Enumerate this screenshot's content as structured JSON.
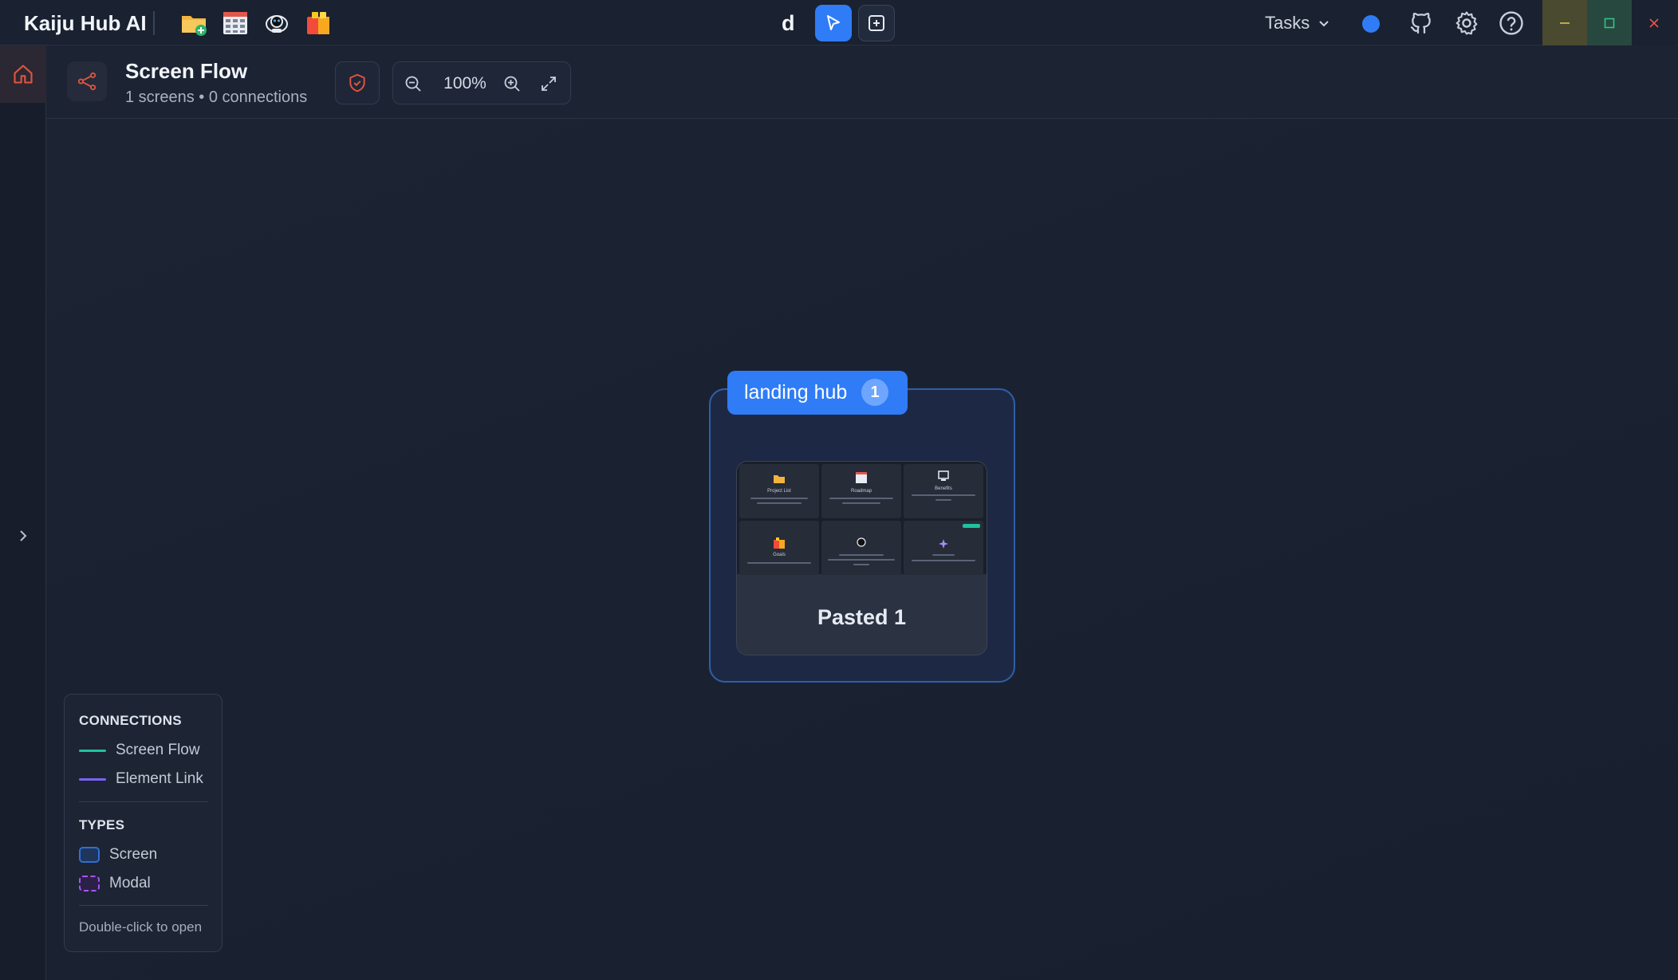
{
  "app": {
    "title": "Kaiju Hub AI",
    "mode_letter": "d",
    "tasks_label": "Tasks",
    "app_icons": [
      "folder-add-icon",
      "grid-table-icon",
      "robot-icon",
      "color-blocks-icon"
    ]
  },
  "header": {
    "title": "Screen Flow",
    "subtitle": "1 screens • 0 connections",
    "zoom_level": "100%"
  },
  "canvas": {
    "group": {
      "label": "landing hub",
      "count": "1"
    },
    "screen": {
      "name": "Pasted 1"
    },
    "thumbnail_tiles": [
      "Project List",
      "Roadmap",
      "Benefits",
      "Goals",
      "",
      ""
    ]
  },
  "legend": {
    "connections_heading": "CONNECTIONS",
    "screen_flow": "Screen Flow",
    "element_link": "Element Link",
    "types_heading": "TYPES",
    "screen": "Screen",
    "modal": "Modal",
    "hint": "Double-click to open"
  },
  "colors": {
    "accent": "#2f7cf6",
    "screen_flow_line": "#1fc2a0",
    "element_link_line": "#7b62f2",
    "modal_border": "#a855f7"
  }
}
